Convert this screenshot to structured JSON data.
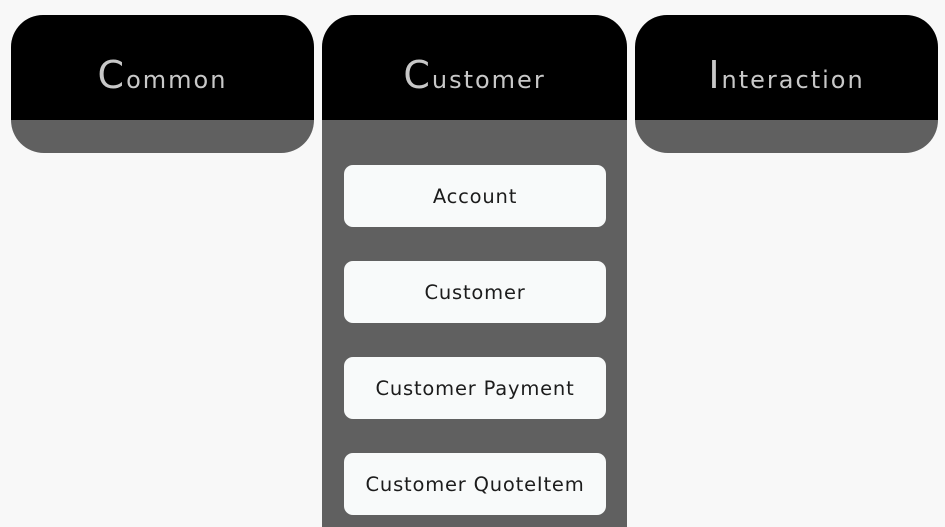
{
  "tabs": [
    {
      "id": "common",
      "label": "Common",
      "expanded": false
    },
    {
      "id": "customer",
      "label": "Customer",
      "expanded": true
    },
    {
      "id": "interaction",
      "label": "Interaction",
      "expanded": false
    }
  ],
  "customer_menu": {
    "items": [
      {
        "label": "Account"
      },
      {
        "label": "Customer"
      },
      {
        "label": "Customer Payment"
      },
      {
        "label": "Customer QuoteItem"
      }
    ]
  },
  "colors": {
    "background": "#f8f8f8",
    "header": "#000000",
    "header_text": "#c8c8c8",
    "panel": "#606060",
    "item": "#f8fafa",
    "item_text": "#1c1c1c"
  }
}
